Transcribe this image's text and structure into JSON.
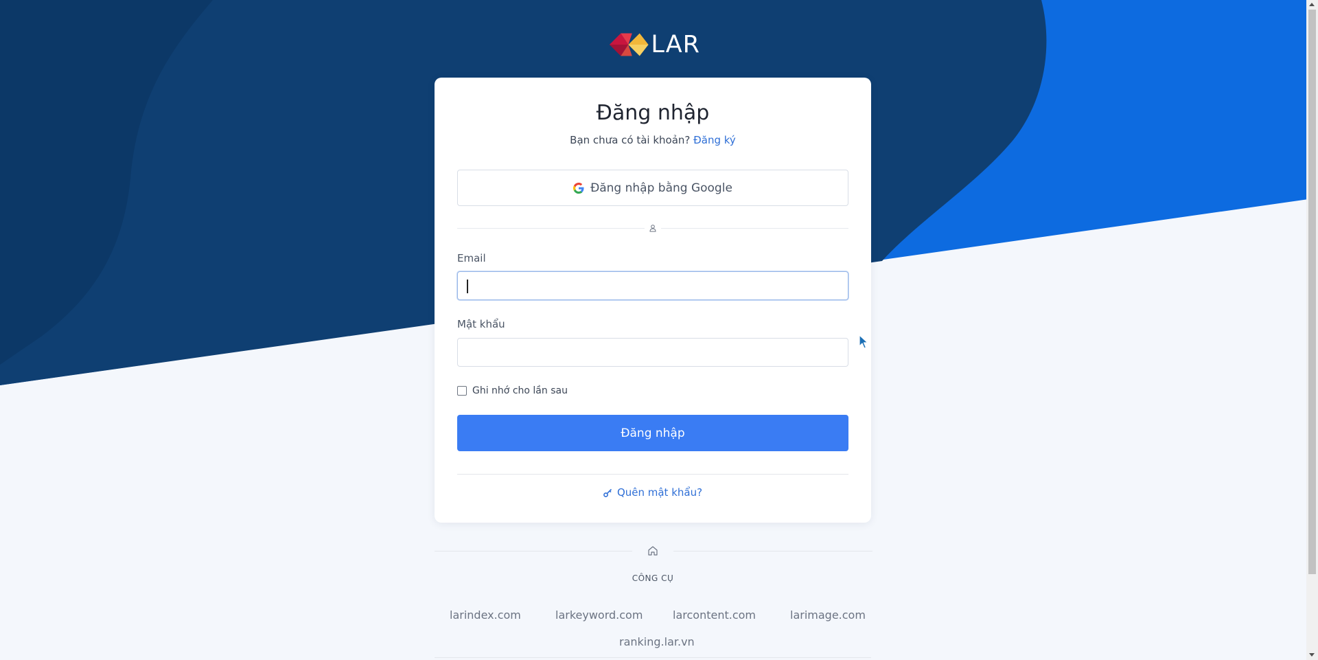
{
  "brand": {
    "name": "LAR"
  },
  "login": {
    "title": "Đăng nhập",
    "no_account_text": "Bạn chưa có tài khoản?",
    "register_link": "Đăng ký",
    "google_button": "Đăng nhập bằng Google",
    "email_label": "Email",
    "email_value": "",
    "password_label": "Mật khẩu",
    "password_value": "",
    "remember_label": "Ghi nhớ cho lần sau",
    "remember_checked": false,
    "submit_button": "Đăng nhập",
    "forgot_link": "Quên mật khẩu?"
  },
  "tools": {
    "heading": "CÔNG CỤ",
    "links": [
      "larindex.com",
      "larkeyword.com",
      "larcontent.com",
      "larimage.com",
      "ranking.lar.vn"
    ]
  },
  "icons": {
    "google": "google-icon",
    "divider": "user-icon",
    "forgot": "key-icon",
    "tools": "home-icon"
  },
  "colors": {
    "dark_blue": "#0f3f72",
    "bright_blue": "#0d6be0",
    "page_bg": "#f4f7fc",
    "primary_button": "#3a7cf3",
    "link": "#2f6fd6"
  }
}
